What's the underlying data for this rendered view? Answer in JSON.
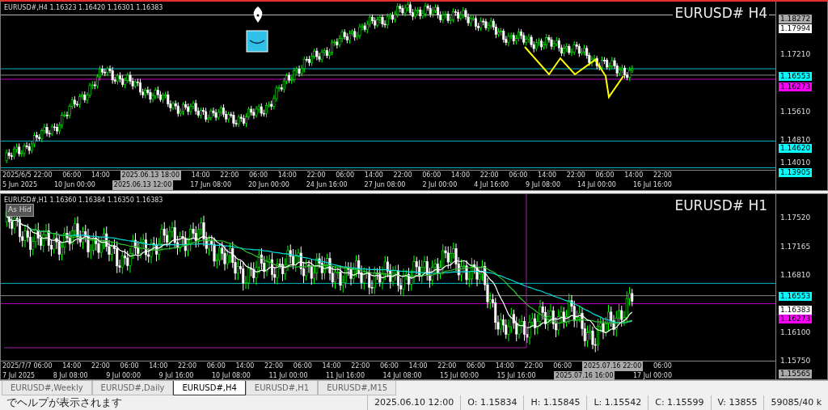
{
  "charts": [
    {
      "header": "EURUSD#,H4  1.16323 1.16420 1.16301 1.16383",
      "title": "EURUSD# H4",
      "kind": "h4",
      "price_labels": [
        {
          "text": "1.18272",
          "kind": "grey"
        },
        {
          "text": "1.17994",
          "kind": "white"
        },
        {
          "text": "1.17210",
          "kind": "tick"
        },
        {
          "text": "1.16553",
          "kind": "cyan"
        },
        {
          "text": "1.16273",
          "kind": "magenta"
        },
        {
          "text": "1.15610",
          "kind": "tick"
        },
        {
          "text": "1.14810",
          "kind": "tick"
        },
        {
          "text": "1.14620",
          "kind": "cyan"
        },
        {
          "text": "1.14010",
          "kind": "tick"
        },
        {
          "text": "1.13905",
          "kind": "cyan"
        }
      ],
      "time_row_1": [
        {
          "text": "2025/6/5 22:00",
          "highlight": false
        },
        {
          "text": "06:00",
          "highlight": false
        },
        {
          "text": "14:00",
          "highlight": false
        },
        {
          "text": "2025.06.13 18:00",
          "highlight": true
        },
        {
          "text": "14:00",
          "highlight": false
        },
        {
          "text": "22:00",
          "highlight": false
        },
        {
          "text": "06:00",
          "highlight": false
        },
        {
          "text": "14:00",
          "highlight": false
        },
        {
          "text": "22:00",
          "highlight": false
        },
        {
          "text": "06:00",
          "highlight": false
        },
        {
          "text": "14:00",
          "highlight": false
        },
        {
          "text": "22:00",
          "highlight": false
        },
        {
          "text": "06:00",
          "highlight": false
        },
        {
          "text": "14:00",
          "highlight": false
        },
        {
          "text": "22:00",
          "highlight": false
        },
        {
          "text": "06:00",
          "highlight": false
        },
        {
          "text": "14:00",
          "highlight": false
        },
        {
          "text": "22:00",
          "highlight": false
        },
        {
          "text": "06:00",
          "highlight": false
        },
        {
          "text": "14:00",
          "highlight": false
        },
        {
          "text": "22:00",
          "highlight": false
        }
      ],
      "time_row_2": [
        {
          "text": "5 Jun 2025",
          "highlight": false
        },
        {
          "text": "10 Jun 00:00",
          "highlight": false
        },
        {
          "text": "2025.06.13 12:00",
          "highlight": true
        },
        {
          "text": "17 Jun 08:00",
          "highlight": false
        },
        {
          "text": "20 Jun 00:00",
          "highlight": false
        },
        {
          "text": "24 Jun 16:00",
          "highlight": false
        },
        {
          "text": "27 Jun 08:00",
          "highlight": false
        },
        {
          "text": "2 Jul 00:00",
          "highlight": false
        },
        {
          "text": "4 Jul 16:00",
          "highlight": false
        },
        {
          "text": "9 Jul 08:00",
          "highlight": false
        },
        {
          "text": "14 Jul 00:00",
          "highlight": false
        },
        {
          "text": "16 Jul 16:00",
          "highlight": false
        }
      ]
    },
    {
      "header": "EURUSD#,H1  1.16360 1.16384 1.16350 1.16383",
      "title": "EURUSD# H1",
      "kind": "h1",
      "tag": "As Hid",
      "price_labels": [
        {
          "text": "1.17520",
          "kind": "tick"
        },
        {
          "text": "1.17165",
          "kind": "tick"
        },
        {
          "text": "1.16810",
          "kind": "tick"
        },
        {
          "text": "1.16553",
          "kind": "cyan"
        },
        {
          "text": "1.16383",
          "kind": "white"
        },
        {
          "text": "1.16273",
          "kind": "magenta"
        },
        {
          "text": "1.16100",
          "kind": "tick"
        },
        {
          "text": "1.15750",
          "kind": "tick"
        },
        {
          "text": "1.15565",
          "kind": "grey"
        }
      ],
      "time_row_1": [
        {
          "text": "2025/7/7 06:00",
          "highlight": false
        },
        {
          "text": "14:00",
          "highlight": false
        },
        {
          "text": "22:00",
          "highlight": false
        },
        {
          "text": "06:00",
          "highlight": false
        },
        {
          "text": "14:00",
          "highlight": false
        },
        {
          "text": "22:00",
          "highlight": false
        },
        {
          "text": "06:00",
          "highlight": false
        },
        {
          "text": "14:00",
          "highlight": false
        },
        {
          "text": "22:00",
          "highlight": false
        },
        {
          "text": "06:00",
          "highlight": false
        },
        {
          "text": "14:00",
          "highlight": false
        },
        {
          "text": "22:00",
          "highlight": false
        },
        {
          "text": "06:00",
          "highlight": false
        },
        {
          "text": "14:00",
          "highlight": false
        },
        {
          "text": "22:00",
          "highlight": false
        },
        {
          "text": "06:00",
          "highlight": false
        },
        {
          "text": "14:00",
          "highlight": false
        },
        {
          "text": "22:00",
          "highlight": false
        },
        {
          "text": "06:00",
          "highlight": false
        },
        {
          "text": "2025.07.16 22:00",
          "highlight": true
        },
        {
          "text": "06:00",
          "highlight": false
        }
      ],
      "time_row_2": [
        {
          "text": "7 Jul 2025",
          "highlight": false
        },
        {
          "text": "8 Jul 08:00",
          "highlight": false
        },
        {
          "text": "9 Jul 00:00",
          "highlight": false
        },
        {
          "text": "9 Jul 16:00",
          "highlight": false
        },
        {
          "text": "10 Jul 08:00",
          "highlight": false
        },
        {
          "text": "11 Jul 00:00",
          "highlight": false
        },
        {
          "text": "11 Jul 16:00",
          "highlight": false
        },
        {
          "text": "14 Jul 08:00",
          "highlight": false
        },
        {
          "text": "15 Jul 00:00",
          "highlight": false
        },
        {
          "text": "15 Jul 16:00",
          "highlight": false
        },
        {
          "text": "2025.07.16 16:00",
          "highlight": true
        },
        {
          "text": "17 Jul 00:00",
          "highlight": false
        }
      ]
    }
  ],
  "tabs": [
    {
      "label": "EURUSD#,Weekly",
      "selected": false
    },
    {
      "label": "EURUSD#,Daily",
      "selected": false
    },
    {
      "label": "EURUSD#,H4",
      "selected": true
    },
    {
      "label": "EURUSD#,H1",
      "selected": false
    },
    {
      "label": "EURUSD#,M15",
      "selected": false
    }
  ],
  "status_bar": {
    "help": "でヘルプが表示されます",
    "cells": [
      "2025.06.10 12:00",
      "O: 1.15834",
      "H: 1.15845",
      "L: 1.15542",
      "C: 1.15599",
      "V: 13855"
    ],
    "connection": "59085/40 k"
  }
}
